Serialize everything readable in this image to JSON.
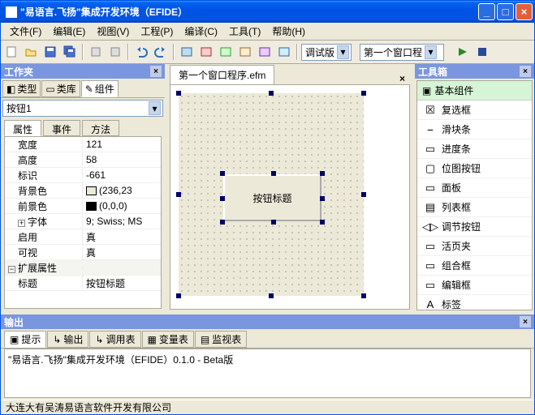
{
  "title": "\"易语言.飞扬\"集成开发环境（EFIDE）",
  "menu": [
    "文件(F)",
    "编辑(E)",
    "视图(V)",
    "工程(P)",
    "编译(C)",
    "工具(T)",
    "帮助(H)"
  ],
  "combo1": "调试版",
  "combo2": "第一个窗口程",
  "workpane": {
    "title": "工作夹",
    "tabs": [
      "类型",
      "类库",
      "组件"
    ],
    "object": "按钮1",
    "subtabs": [
      "属性",
      "事件",
      "方法"
    ]
  },
  "props": [
    {
      "name": "宽度",
      "value": "121"
    },
    {
      "name": "高度",
      "value": "58"
    },
    {
      "name": "标识",
      "value": "-661"
    },
    {
      "name": "背景色",
      "value": "(236,23",
      "swatch": "#ece9d8"
    },
    {
      "name": "前景色",
      "value": "(0,0,0)",
      "swatch": "#000000"
    },
    {
      "name": "字体",
      "value": "9; Swiss; MS",
      "expand": true
    },
    {
      "name": "启用",
      "value": "真"
    },
    {
      "name": "可视",
      "value": "真"
    },
    {
      "cat": true,
      "name": "扩展属性",
      "value": ""
    },
    {
      "name": "标题",
      "value": "按钮标题"
    }
  ],
  "doc_tab": "第一个窗口程序.efm",
  "button_caption": "按钮标题",
  "toolbox": {
    "title": "工具箱",
    "category": "基本组件",
    "items": [
      "复选框",
      "滑块条",
      "进度条",
      "位图按钮",
      "面板",
      "列表框",
      "调节按钮",
      "活页夹",
      "组合框",
      "编辑框",
      "标签"
    ]
  },
  "output": {
    "title": "输出",
    "tabs": [
      "提示",
      "输出",
      "调用表",
      "变量表",
      "监视表"
    ],
    "text": "\"易语言.飞扬\"集成开发环境（EFIDE）0.1.0 - Beta版"
  },
  "statusbar": "大连大有吴涛易语言软件开发有限公司"
}
